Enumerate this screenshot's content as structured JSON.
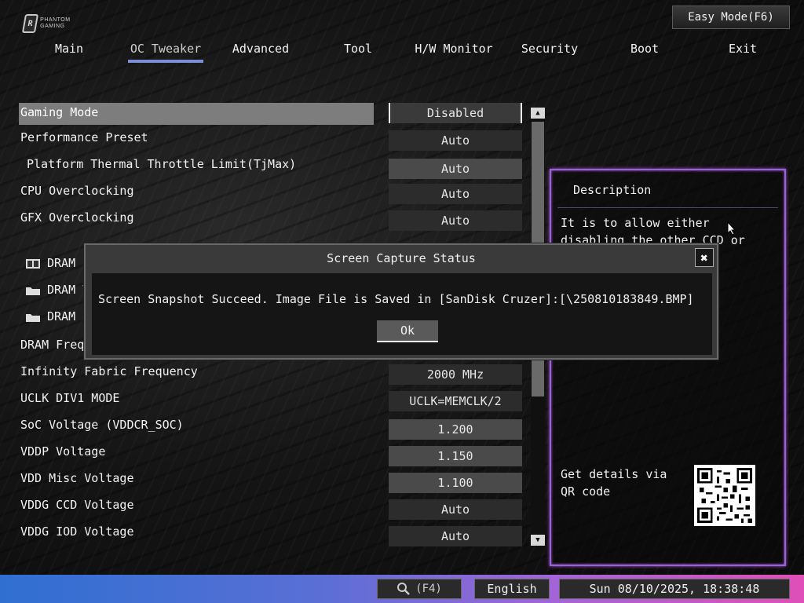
{
  "header": {
    "logo_text": "PHANTOM GAMING",
    "logo_mark": "R",
    "easy_mode_label": "Easy Mode(F6)"
  },
  "nav": {
    "tabs": [
      {
        "label": "Main"
      },
      {
        "label": "OC Tweaker",
        "active": true
      },
      {
        "label": "Advanced"
      },
      {
        "label": "Tool"
      },
      {
        "label": "H/W Monitor"
      },
      {
        "label": "Security"
      },
      {
        "label": "Boot"
      },
      {
        "label": "Exit"
      }
    ]
  },
  "settings": [
    {
      "label": "Gaming Mode",
      "value": "Disabled",
      "selected": true
    },
    {
      "label": "Performance Preset",
      "value": "Auto"
    },
    {
      "label": "Platform Thermal Throttle Limit(TjMax)",
      "value": "Auto",
      "indent": true
    },
    {
      "label": "CPU Overclocking",
      "value": "Auto"
    },
    {
      "label": "GFX Overclocking",
      "value": "Auto"
    },
    {
      "label": "DRAM Profile Configuration",
      "folder": true
    },
    {
      "label": "DRAM T",
      "folder": true
    },
    {
      "label": "DRAM E",
      "folder": true
    },
    {
      "label": "DRAM Frequ"
    },
    {
      "label": "Infinity Fabric Frequency",
      "value": "2000 MHz"
    },
    {
      "label": "UCLK DIV1 MODE",
      "value": "UCLK=MEMCLK/2"
    },
    {
      "label": "SoC Voltage (VDDCR_SOC)",
      "value": "1.200"
    },
    {
      "label": "VDDP Voltage",
      "value": "1.150"
    },
    {
      "label": "VDD Misc Voltage",
      "value": "1.100"
    },
    {
      "label": "VDDG CCD Voltage",
      "value": "Auto"
    },
    {
      "label": "VDDG IOD Voltage",
      "value": "Auto"
    }
  ],
  "description": {
    "title": "Description",
    "text": "It is to allow either disabling the other CCD or SMT to help in games.",
    "qr_label": "Get details via QR code"
  },
  "bottom": {
    "search_label": "(F4)",
    "language": "English",
    "datetime": "Sun 08/10/2025, 18:38:48"
  },
  "modal": {
    "title": "Screen Capture Status",
    "message": "Screen Snapshot Succeed. Image File is Saved in  [SanDisk Cruzer]:[\\250810183849.BMP]",
    "ok_label": "Ok",
    "close_glyph": "✖"
  },
  "colors": {
    "panel_border": "#8a6ad8",
    "bottom_gradient_start": "#2f6fd0",
    "bottom_gradient_end": "#e04fb8",
    "nav_active_underline": "#7b8ed6"
  }
}
